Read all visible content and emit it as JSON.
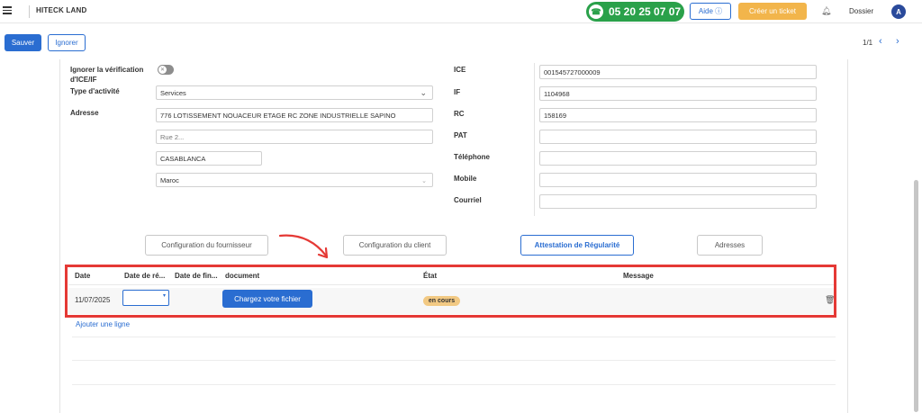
{
  "header": {
    "company": "HITECK LAND",
    "phone": "05 20 25 07 07",
    "help_label": "Aide ⓘ",
    "ticket_label": "Créer un ticket",
    "folder_label": "Dossier",
    "avatar_initial": "A"
  },
  "toolbar": {
    "save_label": "Sauver",
    "ignore_label": "Ignorer",
    "pager": "1/1"
  },
  "form": {
    "ignore_ice_label": "Ignorer la vérification d'ICE/IF",
    "activity_label": "Type d'activité",
    "activity_value": "Services",
    "address_label": "Adresse",
    "address_line1": "776 LOTISSEMENT NOUACEUR ETAGE RC ZONE INDUSTRIELLE SAPINO",
    "address_line2_placeholder": "Rue 2...",
    "city": "CASABLANCA",
    "country": "Maroc",
    "ice_label": "ICE",
    "ice_value": "001545727000009",
    "if_label": "IF",
    "if_value": "1104968",
    "rc_label": "RC",
    "rc_value": "158169",
    "pat_label": "PAT",
    "pat_value": "",
    "phone_label": "Téléphone",
    "phone_value": "",
    "mobile_label": "Mobile",
    "mobile_value": "",
    "email_label": "Courriel",
    "email_value": ""
  },
  "tabs": [
    {
      "label": "Configuration du fournisseur"
    },
    {
      "label": "Configuration du client"
    },
    {
      "label": "Attestation de Régularité"
    },
    {
      "label": "Adresses"
    }
  ],
  "grid": {
    "columns": [
      "Date",
      "Date de ré...",
      "Date de fin...",
      "document",
      "État",
      "Message"
    ],
    "rows": [
      {
        "date": "11/07/2025",
        "upload_label": "Chargez votre fichier",
        "status": "en cours"
      }
    ],
    "add_line_label": "Ajouter une ligne"
  },
  "colors": {
    "primary": "#2a6dd1",
    "phone_green": "#2aa14a",
    "ticket_orange": "#f2b54b",
    "highlight_red": "#e53935",
    "badge_amber": "#f2c983"
  }
}
